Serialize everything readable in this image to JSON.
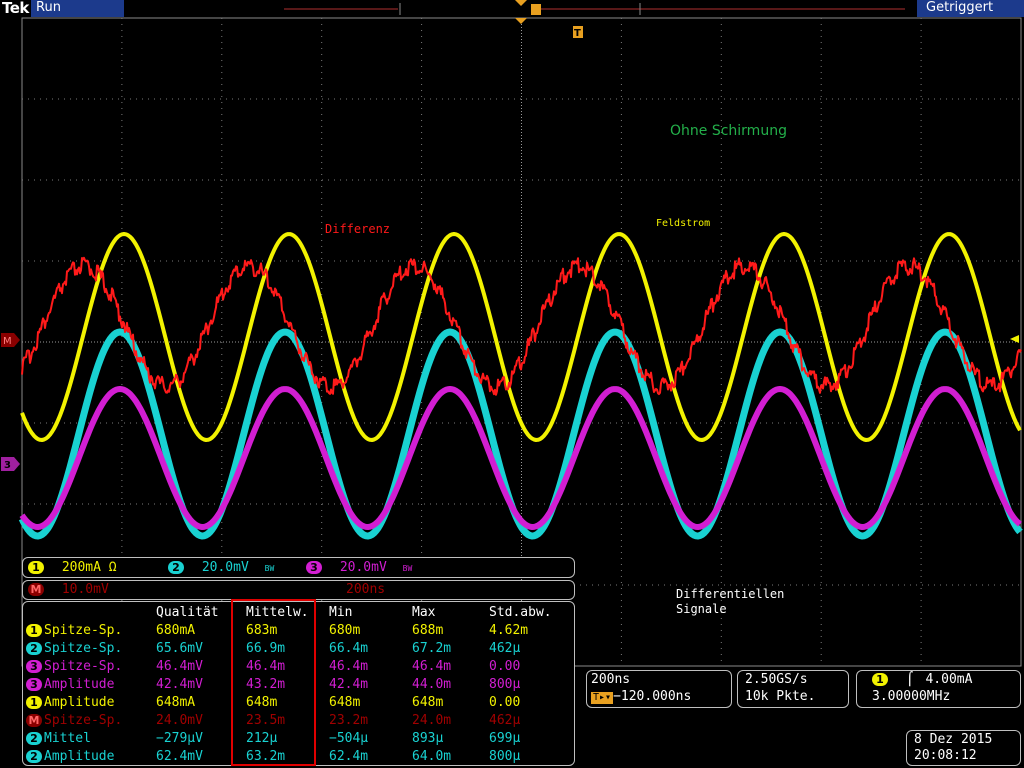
{
  "header": {
    "logo": "Tek",
    "run_state": "Run",
    "trigger_state": "Getriggert",
    "trigger_marker_label": "T"
  },
  "colors": {
    "ch1": "#f2f200",
    "ch2": "#19d2d2",
    "ch3": "#d21ed2",
    "math": "#ff1a1a",
    "graticule": "#7a7a7a",
    "annotation_green": "#23b04a",
    "highlight": "#e00000"
  },
  "markers": {
    "math_marker": "M",
    "ch3_marker": "3"
  },
  "annotations": {
    "shielding": "Ohne Schirmung",
    "differenz": "Differenz",
    "feldstrom": "Feldstrom",
    "diff_signals_line1": "Differentiellen",
    "diff_signals_line2": "Signale"
  },
  "channel_bar": {
    "ch1": {
      "num": "1",
      "scale": "200mA Ω"
    },
    "ch2": {
      "num": "2",
      "scale": "20.0mV",
      "bw": "BW"
    },
    "ch3": {
      "num": "3",
      "scale": "20.0mV",
      "bw": "BW"
    },
    "math": {
      "num": "M",
      "scale": "10.0mV",
      "time": "200ns"
    }
  },
  "measurements": {
    "headers": [
      "",
      "Qualität",
      "Mittelw.",
      "Min",
      "Max",
      "Std.abw."
    ],
    "rows": [
      {
        "ch": "1",
        "name": "Spitze-Sp.",
        "value": "680mA",
        "mean": "683m",
        "min": "680m",
        "max": "688m",
        "std": "4.62m"
      },
      {
        "ch": "2",
        "name": "Spitze-Sp.",
        "value": "65.6mV",
        "mean": "66.9m",
        "min": "66.4m",
        "max": "67.2m",
        "std": "462µ"
      },
      {
        "ch": "3",
        "name": "Spitze-Sp.",
        "value": "46.4mV",
        "mean": "46.4m",
        "min": "46.4m",
        "max": "46.4m",
        "std": "0.00"
      },
      {
        "ch": "3",
        "name": "Amplitude",
        "value": "42.4mV",
        "mean": "43.2m",
        "min": "42.4m",
        "max": "44.0m",
        "std": "800µ"
      },
      {
        "ch": "1",
        "name": "Amplitude",
        "value": "648mA",
        "mean": "648m",
        "min": "648m",
        "max": "648m",
        "std": "0.00"
      },
      {
        "ch": "M",
        "name": "Spitze-Sp.",
        "value": "24.0mV",
        "mean": "23.5m",
        "min": "23.2m",
        "max": "24.0m",
        "std": "462µ"
      },
      {
        "ch": "2",
        "name": "Mittel",
        "value": "−279µV",
        "mean": "212µ",
        "min": "−504µ",
        "max": "893µ",
        "std": "699µ"
      },
      {
        "ch": "2",
        "name": "Amplitude",
        "value": "62.4mV",
        "mean": "63.2m",
        "min": "62.4m",
        "max": "64.0m",
        "std": "800µ"
      }
    ]
  },
  "timebase": {
    "scale": "200ns",
    "position": "−120.000ns"
  },
  "acquisition": {
    "rate": "2.50GS/s",
    "length": "10k Pkte."
  },
  "trigger": {
    "source": "1",
    "slope_icon": "rising-edge-icon",
    "level": "4.00mA",
    "frequency": "3.00000MHz"
  },
  "datetime": {
    "date": "8 Dez  2015",
    "time": "20:08:12"
  }
}
